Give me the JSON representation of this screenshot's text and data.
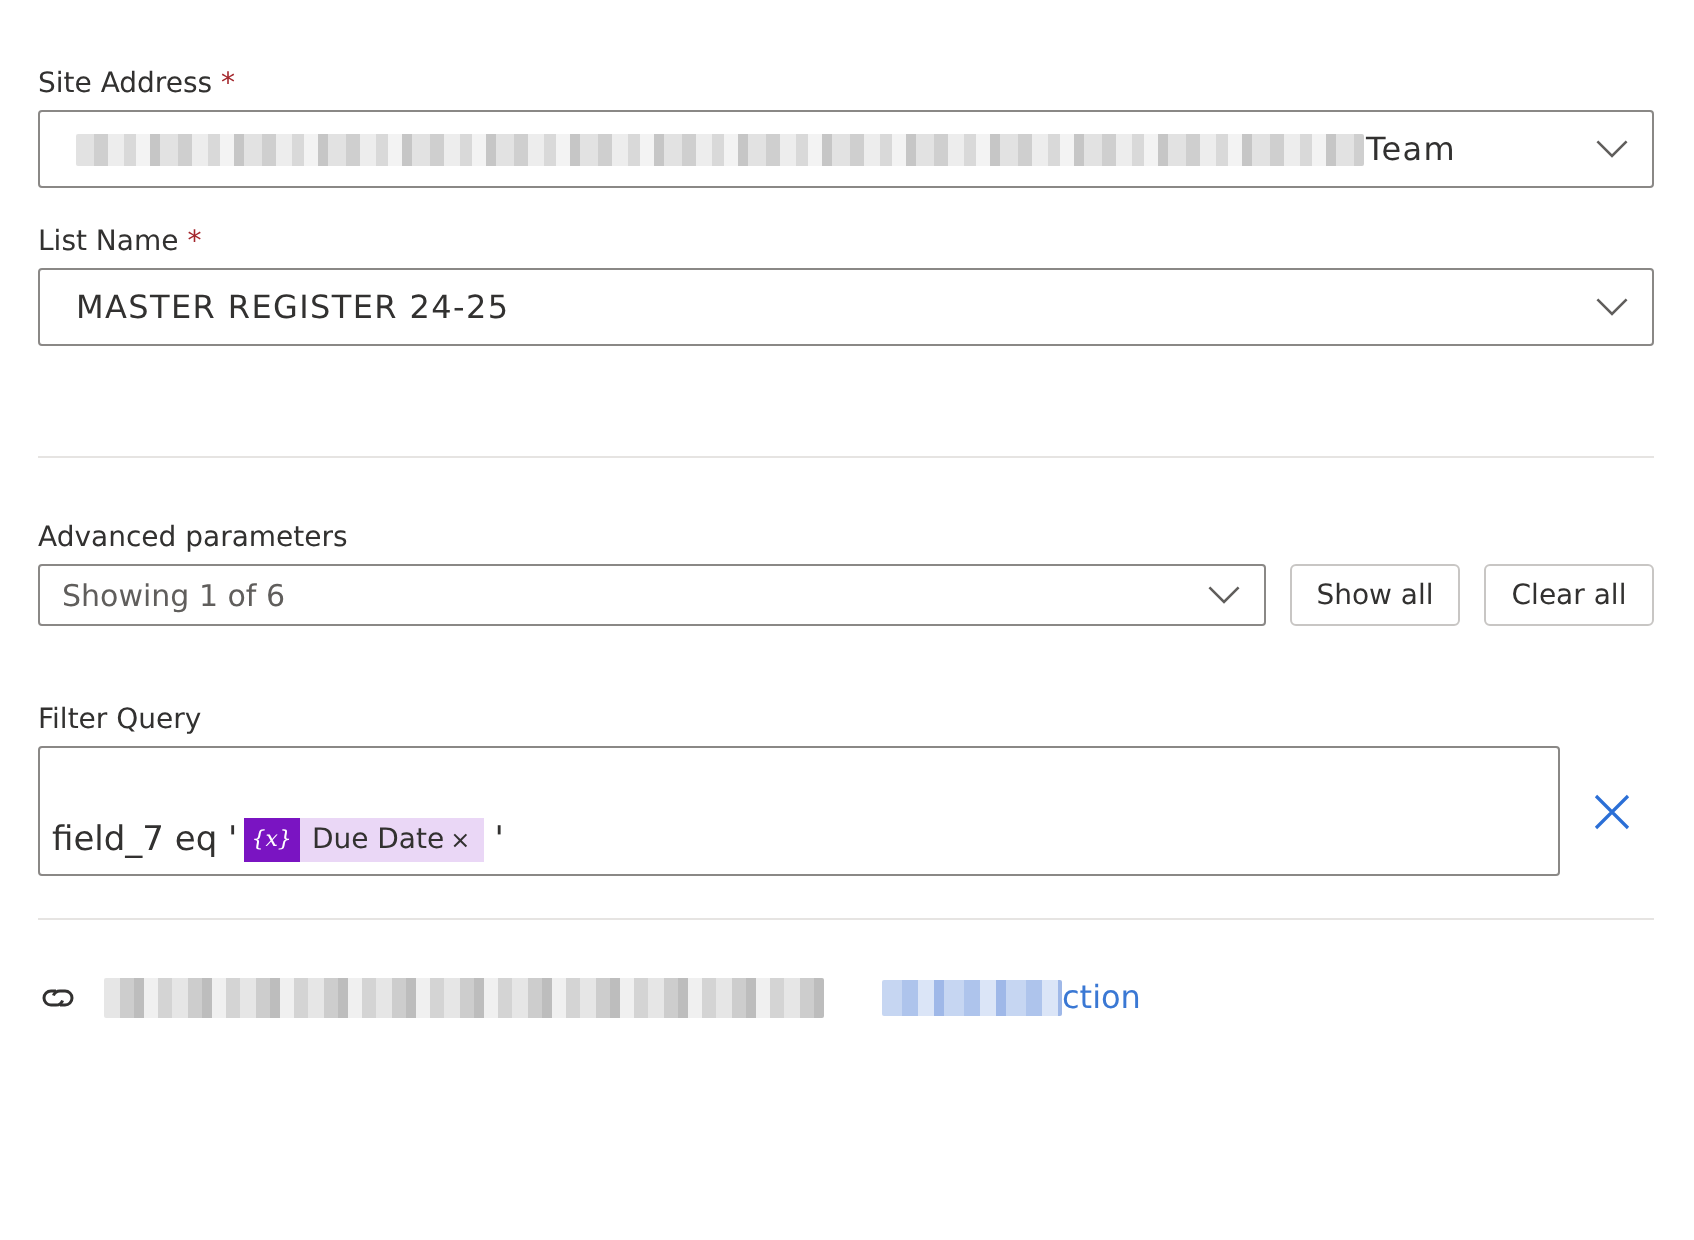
{
  "site_address": {
    "label": "Site Address",
    "required_mark": "*",
    "redacted": true,
    "value": "Team"
  },
  "list_name": {
    "label": "List Name",
    "required_mark": "*",
    "value": "MASTER REGISTER 24-25"
  },
  "advanced_parameters": {
    "label": "Advanced parameters",
    "value": "Showing 1 of 6",
    "buttons": [
      "Show all",
      "Clear all"
    ]
  },
  "filter_query": {
    "label": "Filter Query",
    "segments": [
      {
        "kind": "text",
        "text": "field_7 eq '"
      },
      {
        "kind": "token",
        "icon": "{x}",
        "text": "Due Date",
        "remove": "×"
      },
      {
        "kind": "text",
        "text": "'"
      }
    ]
  },
  "connection": {
    "redacted": true,
    "link_redacted": true,
    "link": "ction"
  }
}
